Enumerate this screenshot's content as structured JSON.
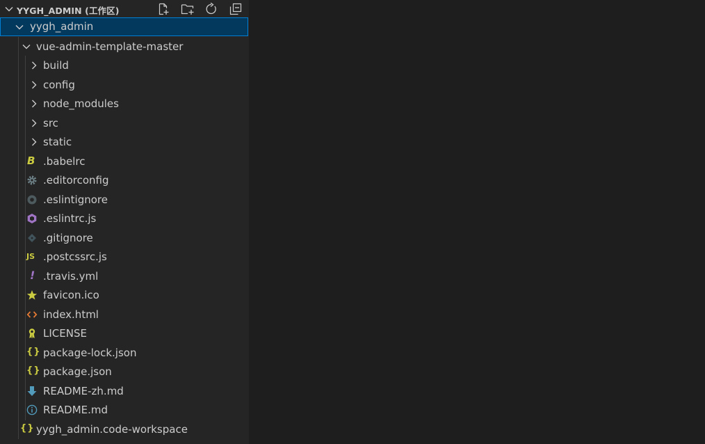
{
  "explorer": {
    "workspace_title": "YYGH_ADMIN (工作区)",
    "toolbar": [
      "new-file-icon",
      "new-folder-icon",
      "refresh-icon",
      "collapse-all-icon"
    ],
    "root_folder": "yygh_admin",
    "project_folder": "vue-admin-template-master",
    "folders": [
      "build",
      "config",
      "node_modules",
      "src",
      "static"
    ],
    "files": [
      {
        "name": ".babelrc",
        "icon": "babel-icon"
      },
      {
        "name": ".editorconfig",
        "icon": "gear-icon"
      },
      {
        "name": ".eslintignore",
        "icon": "eslint-ignore-icon"
      },
      {
        "name": ".eslintrc.js",
        "icon": "eslint-icon"
      },
      {
        "name": ".gitignore",
        "icon": "git-icon"
      },
      {
        "name": ".postcssrc.js",
        "icon": "js-icon"
      },
      {
        "name": ".travis.yml",
        "icon": "yaml-exclamation-icon"
      },
      {
        "name": "favicon.ico",
        "icon": "star-icon"
      },
      {
        "name": "index.html",
        "icon": "html-icon"
      },
      {
        "name": "LICENSE",
        "icon": "license-icon"
      },
      {
        "name": "package-lock.json",
        "icon": "json-icon"
      },
      {
        "name": "package.json",
        "icon": "json-icon"
      },
      {
        "name": "README-zh.md",
        "icon": "download-arrow-icon"
      },
      {
        "name": "README.md",
        "icon": "info-icon"
      }
    ],
    "workspace_file": "yygh_admin.code-workspace"
  },
  "colors": {
    "sidebar_bg": "#252526",
    "editor_bg": "#1e1e1e",
    "selection_bg": "#04395e",
    "selection_border": "#007fd4",
    "json_icon": "#cbcb41",
    "html_icon": "#e37933",
    "eslint_icon": "#a074c4",
    "info_icon": "#519aba"
  }
}
